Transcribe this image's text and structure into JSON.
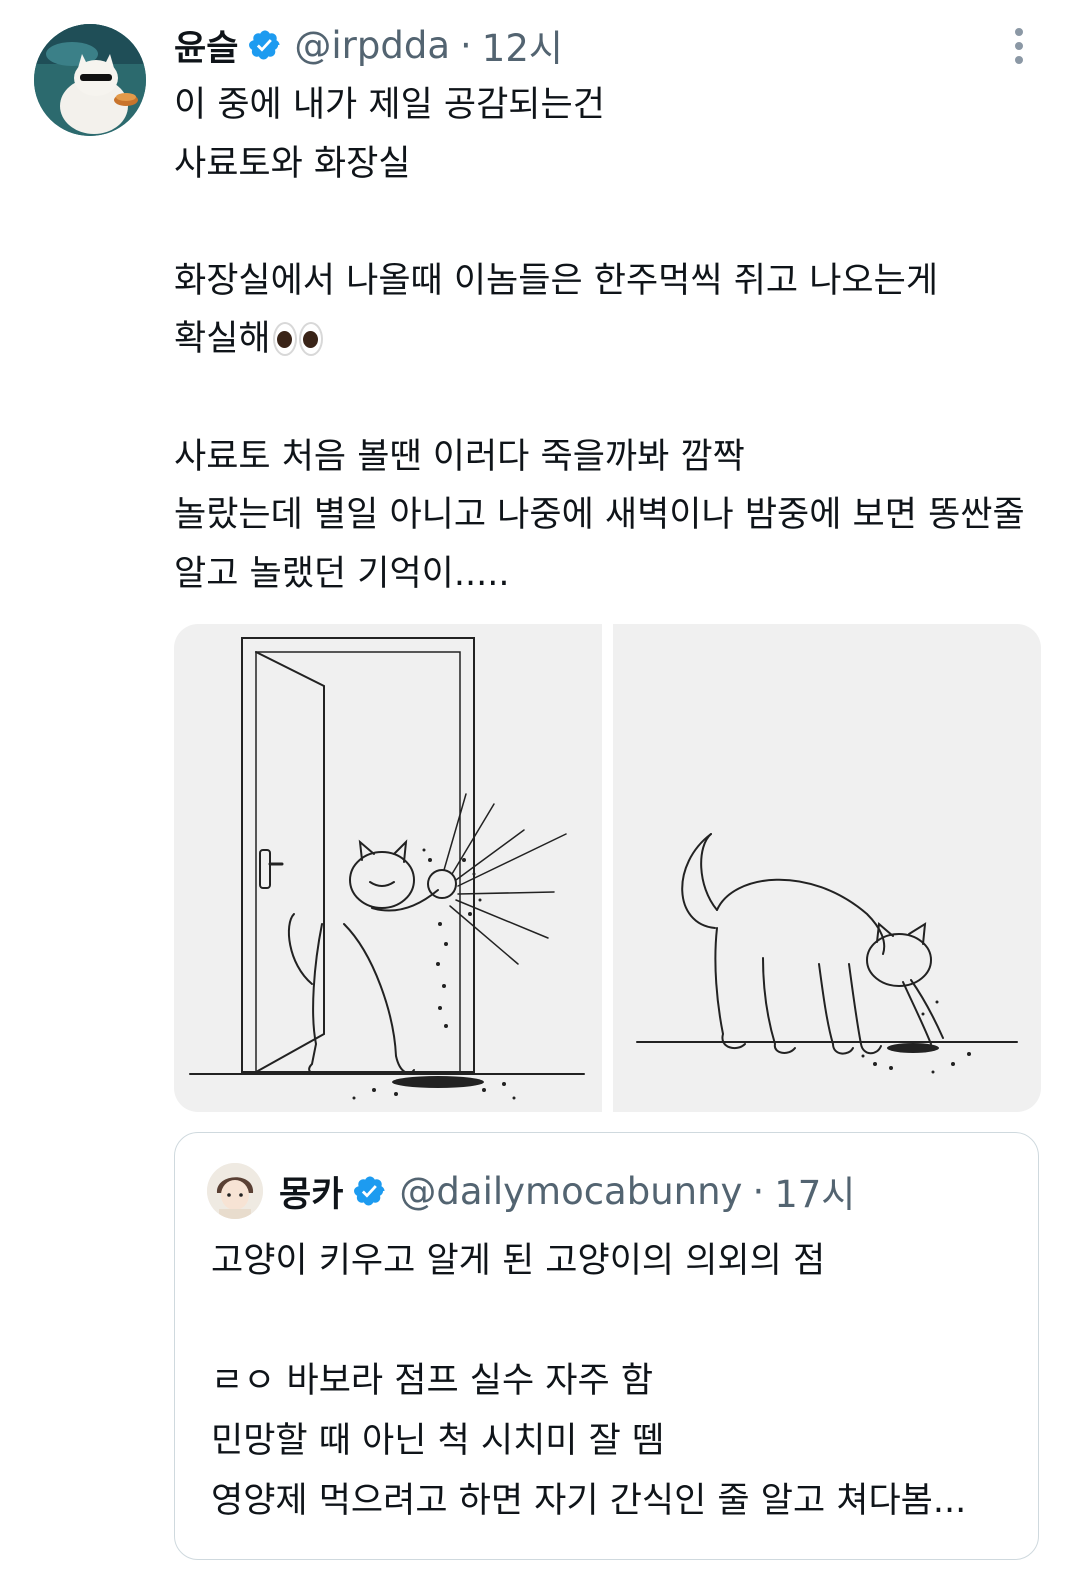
{
  "tweet": {
    "author_name": "윤슬",
    "handle": "@irpdda",
    "separator": "·",
    "time": "12시",
    "verified": true,
    "body_lines": [
      "이 중에 내가 제일 공감되는건",
      "사료토와 화장실",
      "",
      "화장실에서 나올때 이놈들은 한주먹씩 쥐고 나오는게",
      "확실해",
      "",
      "사료토 처음 볼땐 이러다 죽을까봐 깜짝",
      "놀랐는데 별일 아니고 나중에 새벽이나 밤중에 보면 똥싼줄",
      "알고 놀랬던 기억이....."
    ],
    "emoji": "eyes-emoji"
  },
  "quote": {
    "author_name": "몽카",
    "handle": "@dailymocabunny",
    "separator": "·",
    "time": "17시",
    "verified": true,
    "body_lines": [
      "고양이 키우고 알게 된 고양이의 의외의 점",
      "",
      "ㄹㅇ 바보라 점프 실수 자주 함",
      "민망할 때 아닌 척 시치미 잘 뗌",
      "영양제 먹으려고 하면 자기 간식인 줄 알고 쳐다봄..."
    ]
  },
  "colors": {
    "text": "#0f1419",
    "secondary": "#536471",
    "verified_blue": "#1d9bf0",
    "border": "#cfd9de",
    "image_bg": "#f0f0f0"
  },
  "icons": [
    "verified-badge-icon",
    "more-options-icon",
    "eyes-emoji"
  ]
}
